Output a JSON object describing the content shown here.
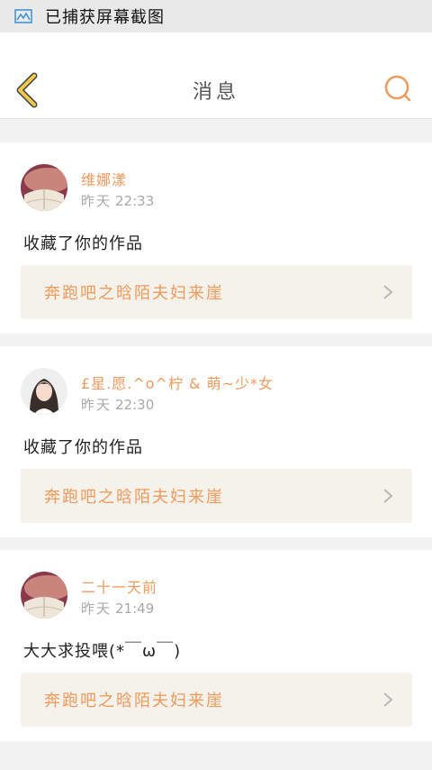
{
  "status_bar": {
    "text": "已捕获屏幕截图",
    "icon": "screenshot-icon"
  },
  "header": {
    "title": "消息",
    "back_icon": "chevron-left-icon",
    "search_icon": "search-icon"
  },
  "colors": {
    "accent": "#f2995c",
    "back_arrow": "#f1c94a",
    "link_bg": "#f4f2ea"
  },
  "messages": [
    {
      "user": "维娜漾",
      "time_prefix": "昨天",
      "time": "22:33",
      "comment": "收藏了你的作品",
      "work": "奔跑吧之晗陌夫妇来崖"
    },
    {
      "user": "£星.愿.^o^柠 & 萌~少*女",
      "time_prefix": "昨天",
      "time": "22:30",
      "comment": "收藏了你的作品",
      "work": "奔跑吧之晗陌夫妇来崖"
    },
    {
      "user": "二十一天前",
      "time_prefix": "昨天",
      "time": "21:49",
      "comment": "大大求投喂(*￣ω￣)",
      "work": "奔跑吧之晗陌夫妇来崖"
    }
  ]
}
